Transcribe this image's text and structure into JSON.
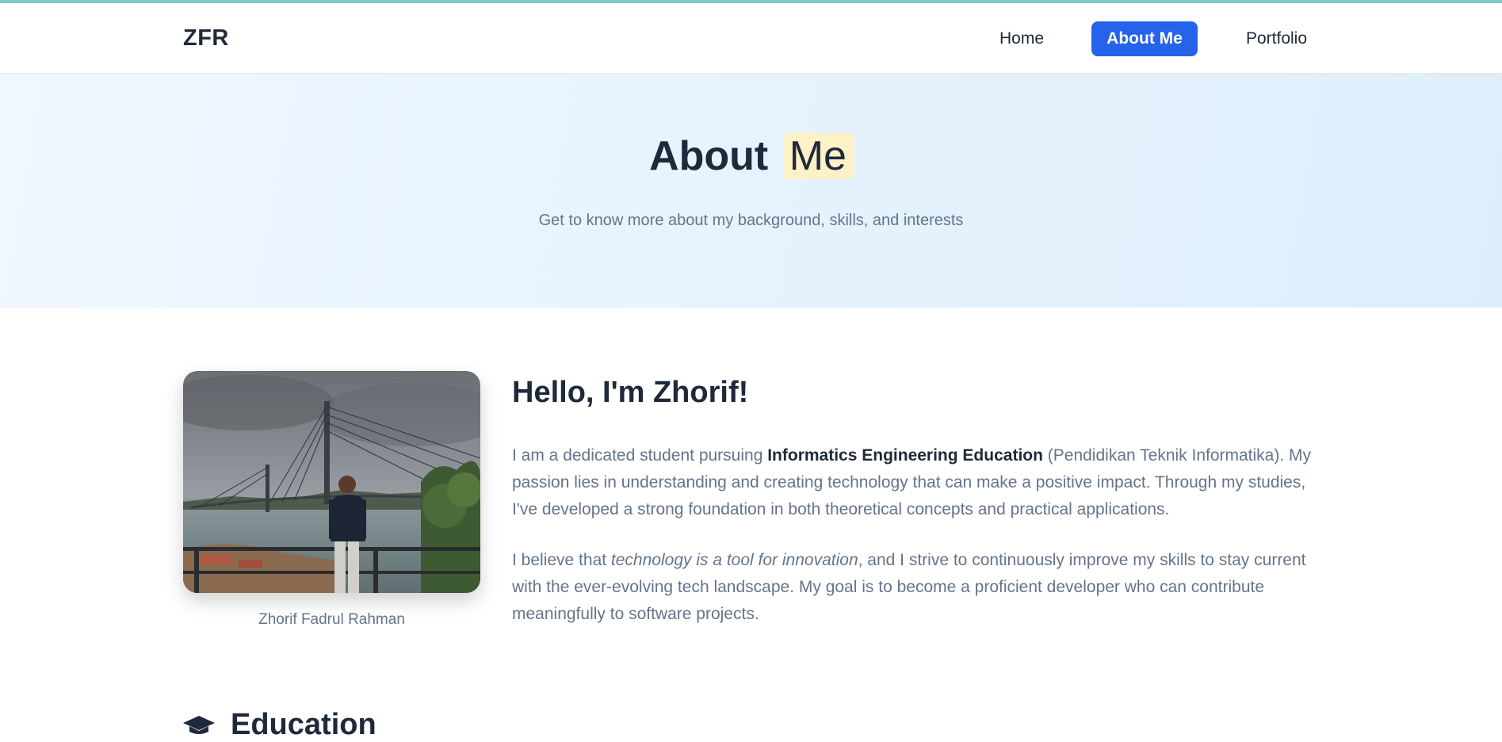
{
  "nav": {
    "brand": "ZFR",
    "links": [
      {
        "label": "Home",
        "active": false
      },
      {
        "label": "About Me",
        "active": true
      },
      {
        "label": "Portfolio",
        "active": false
      }
    ],
    "active_color": "#2563eb"
  },
  "hero": {
    "title_main": "About",
    "title_highlight": "Me",
    "subtitle": "Get to know more about my background, skills, and interests",
    "highlight_color": "#fdf1c7"
  },
  "profile": {
    "photo_icon": "profile-photo-bridge",
    "caption": "Zhorif Fadrul Rahman"
  },
  "intro": {
    "greeting": "Hello, I'm Zhorif!",
    "p1_before": "I am a dedicated student pursuing ",
    "p1_bold": "Informatics Engineering Education",
    "p1_after": " (Pendidikan Teknik Informatika). My passion lies in understanding and creating technology that can make a positive impact. Through my studies, I've developed a strong foundation in both theoretical concepts and practical applications.",
    "p2_before": "I believe that ",
    "p2_italic": "technology is a tool for innovation",
    "p2_after": ", and I strive to continuously improve my skills to stay current with the ever-evolving tech landscape. My goal is to become a proficient developer who can contribute meaningfully to software projects."
  },
  "education": {
    "title": "Education",
    "icon": "graduation-cap-icon"
  }
}
